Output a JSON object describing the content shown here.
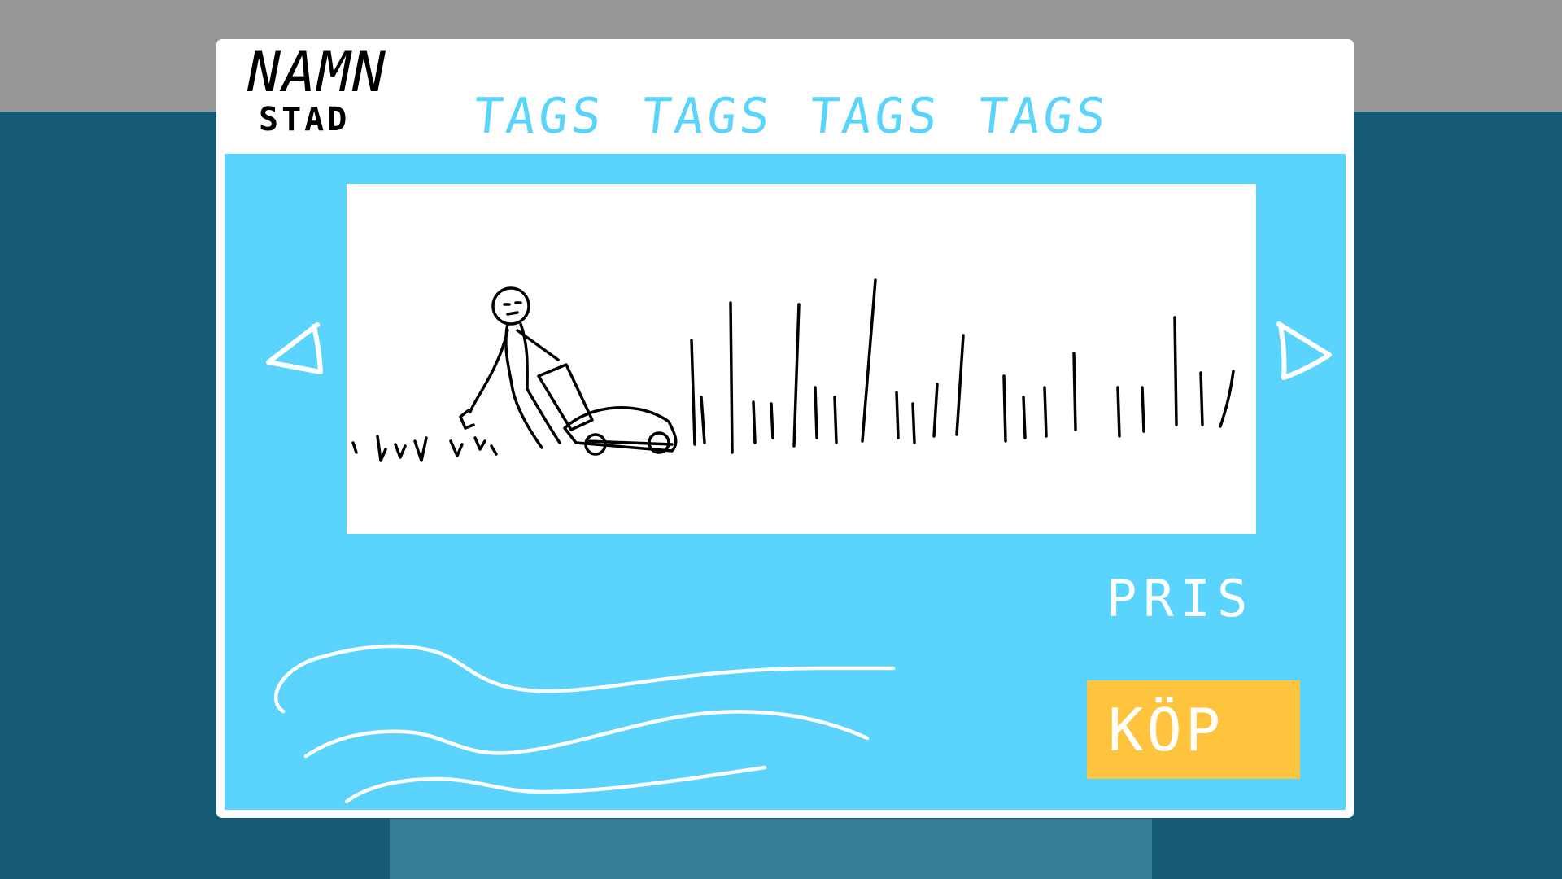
{
  "header": {
    "name": "NAMN",
    "city": "STAD",
    "tags": [
      "TAGS",
      "TAGS",
      "TAGS",
      "TAGS"
    ]
  },
  "listing": {
    "price_label": "PRIS",
    "buy_label": "KÖP"
  },
  "colors": {
    "background": "#155a75",
    "topbar": "#989898",
    "card": "#ffffff",
    "content_panel": "#5ad4fd",
    "tag_text": "#5ad4fa",
    "buy_button": "#fec43e",
    "bottom_block": "#367e98"
  },
  "icons": {
    "prev": "triangle-left-icon",
    "next": "triangle-right-icon"
  }
}
